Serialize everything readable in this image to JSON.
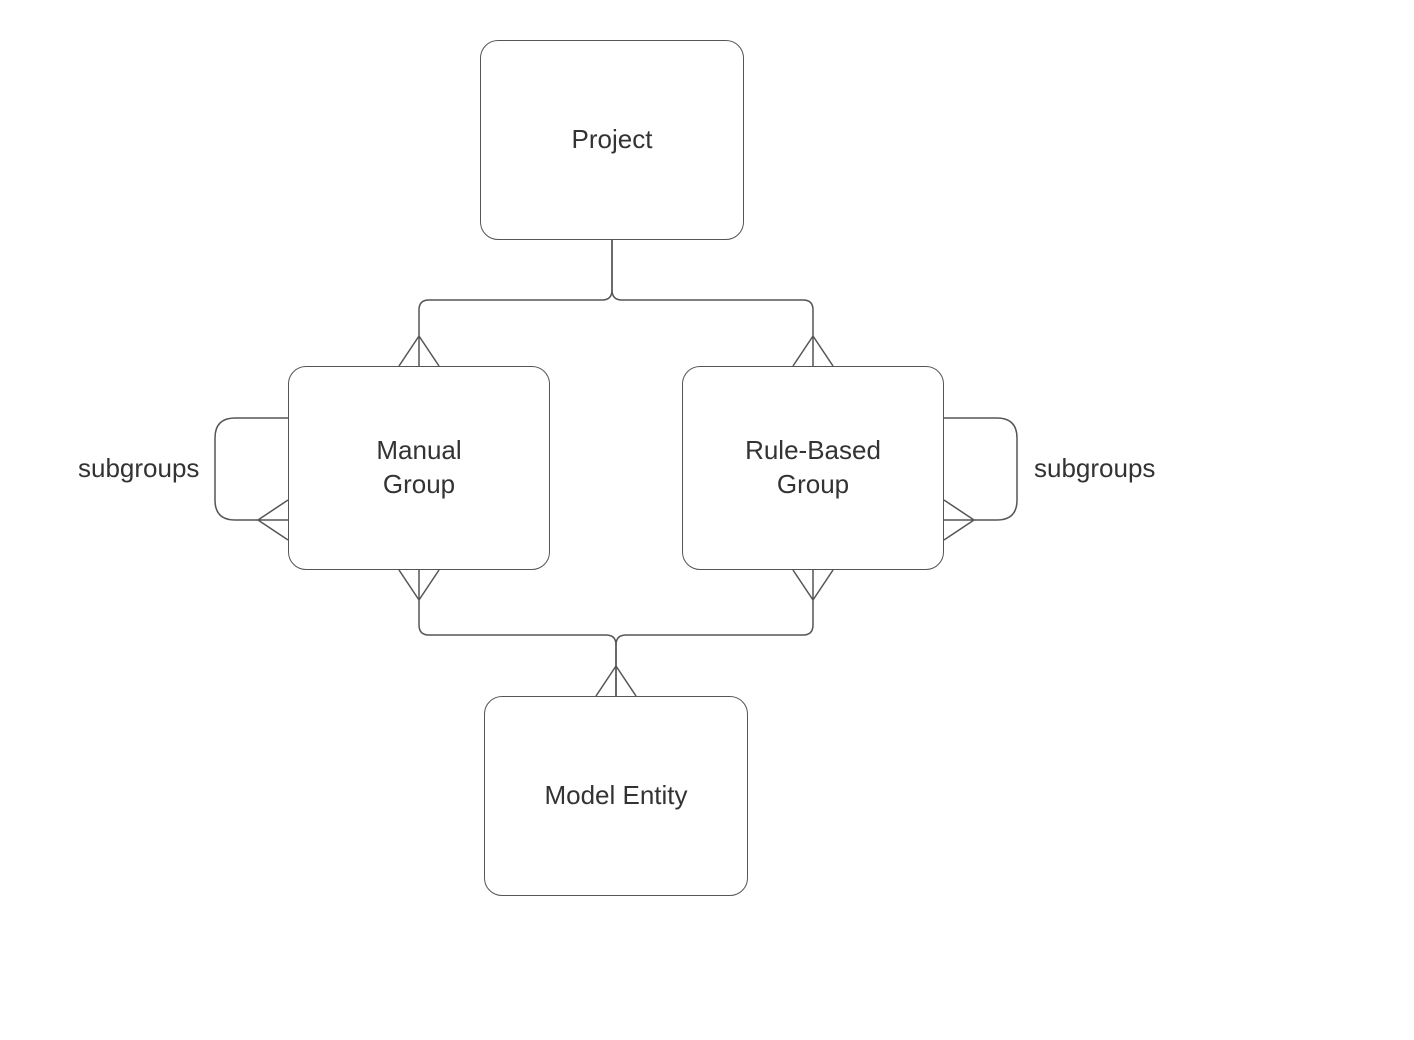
{
  "nodes": {
    "project": {
      "label": "Project"
    },
    "manual_group": {
      "label": "Manual\nGroup"
    },
    "rule_based_group": {
      "label": "Rule-Based\nGroup"
    },
    "model_entity": {
      "label": "Model Entity"
    }
  },
  "labels": {
    "subgroups_left": "subgroups",
    "subgroups_right": "subgroups"
  },
  "colors": {
    "stroke": "#555555",
    "text": "#333333",
    "background": "#ffffff"
  }
}
